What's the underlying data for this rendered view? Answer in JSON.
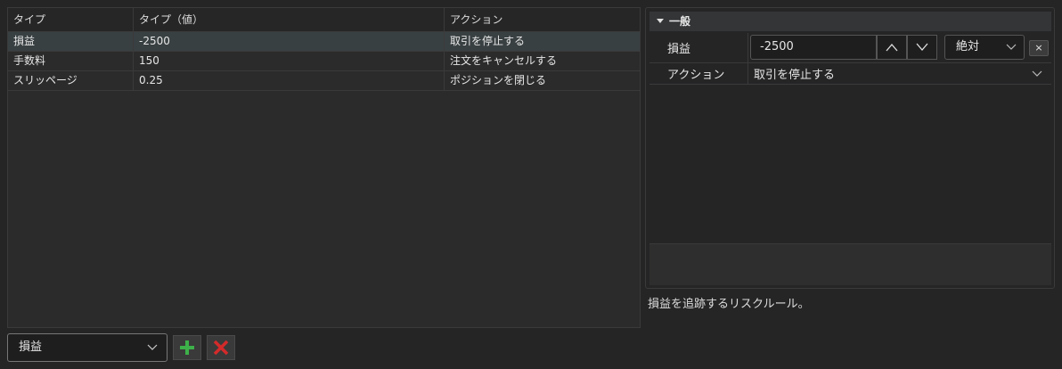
{
  "grid": {
    "columns": [
      "タイプ",
      "タイプ（値）",
      "アクション"
    ],
    "rows": [
      {
        "type": "損益",
        "value": "-2500",
        "action": "取引を停止する"
      },
      {
        "type": "手数料",
        "value": "150",
        "action": "注文をキャンセルする"
      },
      {
        "type": "スリッページ",
        "value": "0.25",
        "action": "ポジションを閉じる"
      }
    ]
  },
  "properties": {
    "category": "一般",
    "pnl_label": "損益",
    "pnl_value": "-2500",
    "mode_value": "絶対",
    "clear_label": "×",
    "action_label": "アクション",
    "action_value": "取引を停止する"
  },
  "description": "損益を追跡するリスクルール。",
  "bottom": {
    "rule_type_value": "損益"
  },
  "colors": {
    "add": "#3db04a",
    "delete": "#d42a2a",
    "selected_row": "#394042"
  },
  "icons": [
    "chevron-up-icon",
    "chevron-down-icon",
    "plus-icon",
    "close-icon",
    "collapse-triangle-icon"
  ]
}
